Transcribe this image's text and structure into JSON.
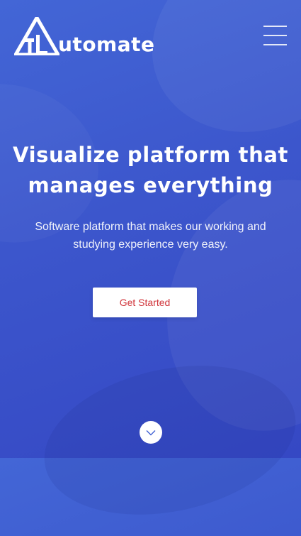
{
  "header": {
    "logo_text": "utomate",
    "logo_letter_icon": "logo-a-icon",
    "menu_icon": "hamburger-menu-icon"
  },
  "hero": {
    "headline_line1": "Visualize platform that",
    "headline_line2": "manages everything",
    "subtext": "Software platform that makes our working and studying experience very easy.",
    "cta_label": "Get Started",
    "scroll_icon": "chevron-down-icon"
  },
  "colors": {
    "background_start": "#4366d6",
    "background_end": "#3548c4",
    "cta_text": "#d0343a",
    "text": "#ffffff"
  }
}
